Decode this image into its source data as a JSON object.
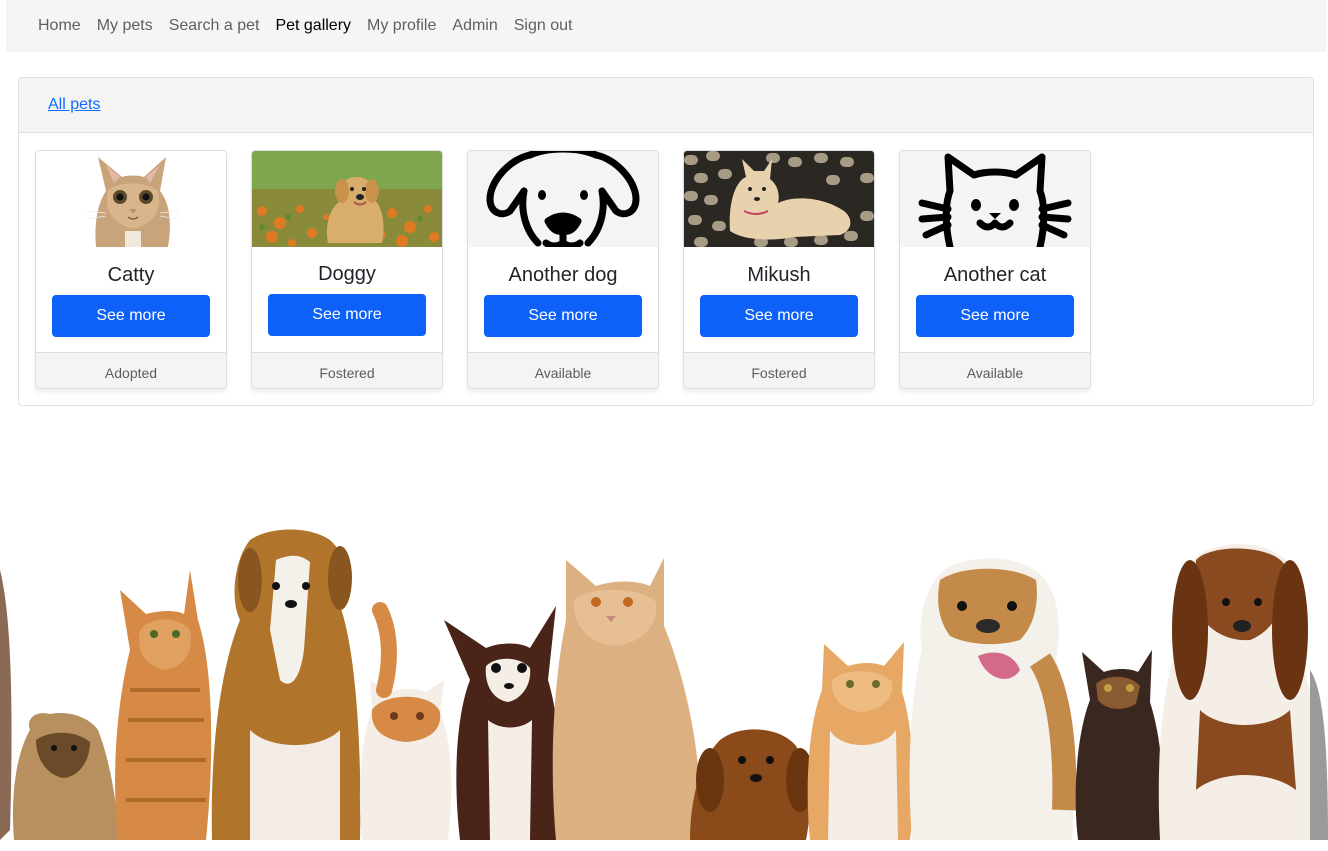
{
  "nav": {
    "items": [
      {
        "label": "Home",
        "active": false
      },
      {
        "label": "My pets",
        "active": false
      },
      {
        "label": "Search a pet",
        "active": false
      },
      {
        "label": "Pet gallery",
        "active": true
      },
      {
        "label": "My profile",
        "active": false
      },
      {
        "label": "Admin",
        "active": false
      },
      {
        "label": "Sign out",
        "active": false
      }
    ]
  },
  "gallery": {
    "header_link": "All pets",
    "button_label": "See more",
    "pets": [
      {
        "name": "Catty",
        "status": "Adopted",
        "image": "cat-photo"
      },
      {
        "name": "Doggy",
        "status": "Fostered",
        "image": "puppy-photo"
      },
      {
        "name": "Another dog",
        "status": "Available",
        "image": "dog-outline-icon"
      },
      {
        "name": "Mikush",
        "status": "Fostered",
        "image": "dog-on-couch-photo"
      },
      {
        "name": "Another cat",
        "status": "Available",
        "image": "cat-outline-icon"
      }
    ]
  },
  "colors": {
    "primary": "#0d60f8",
    "link": "#0d6efd",
    "navbar_bg": "#f4f5f7",
    "card_footer_bg": "#f4f4f4"
  }
}
